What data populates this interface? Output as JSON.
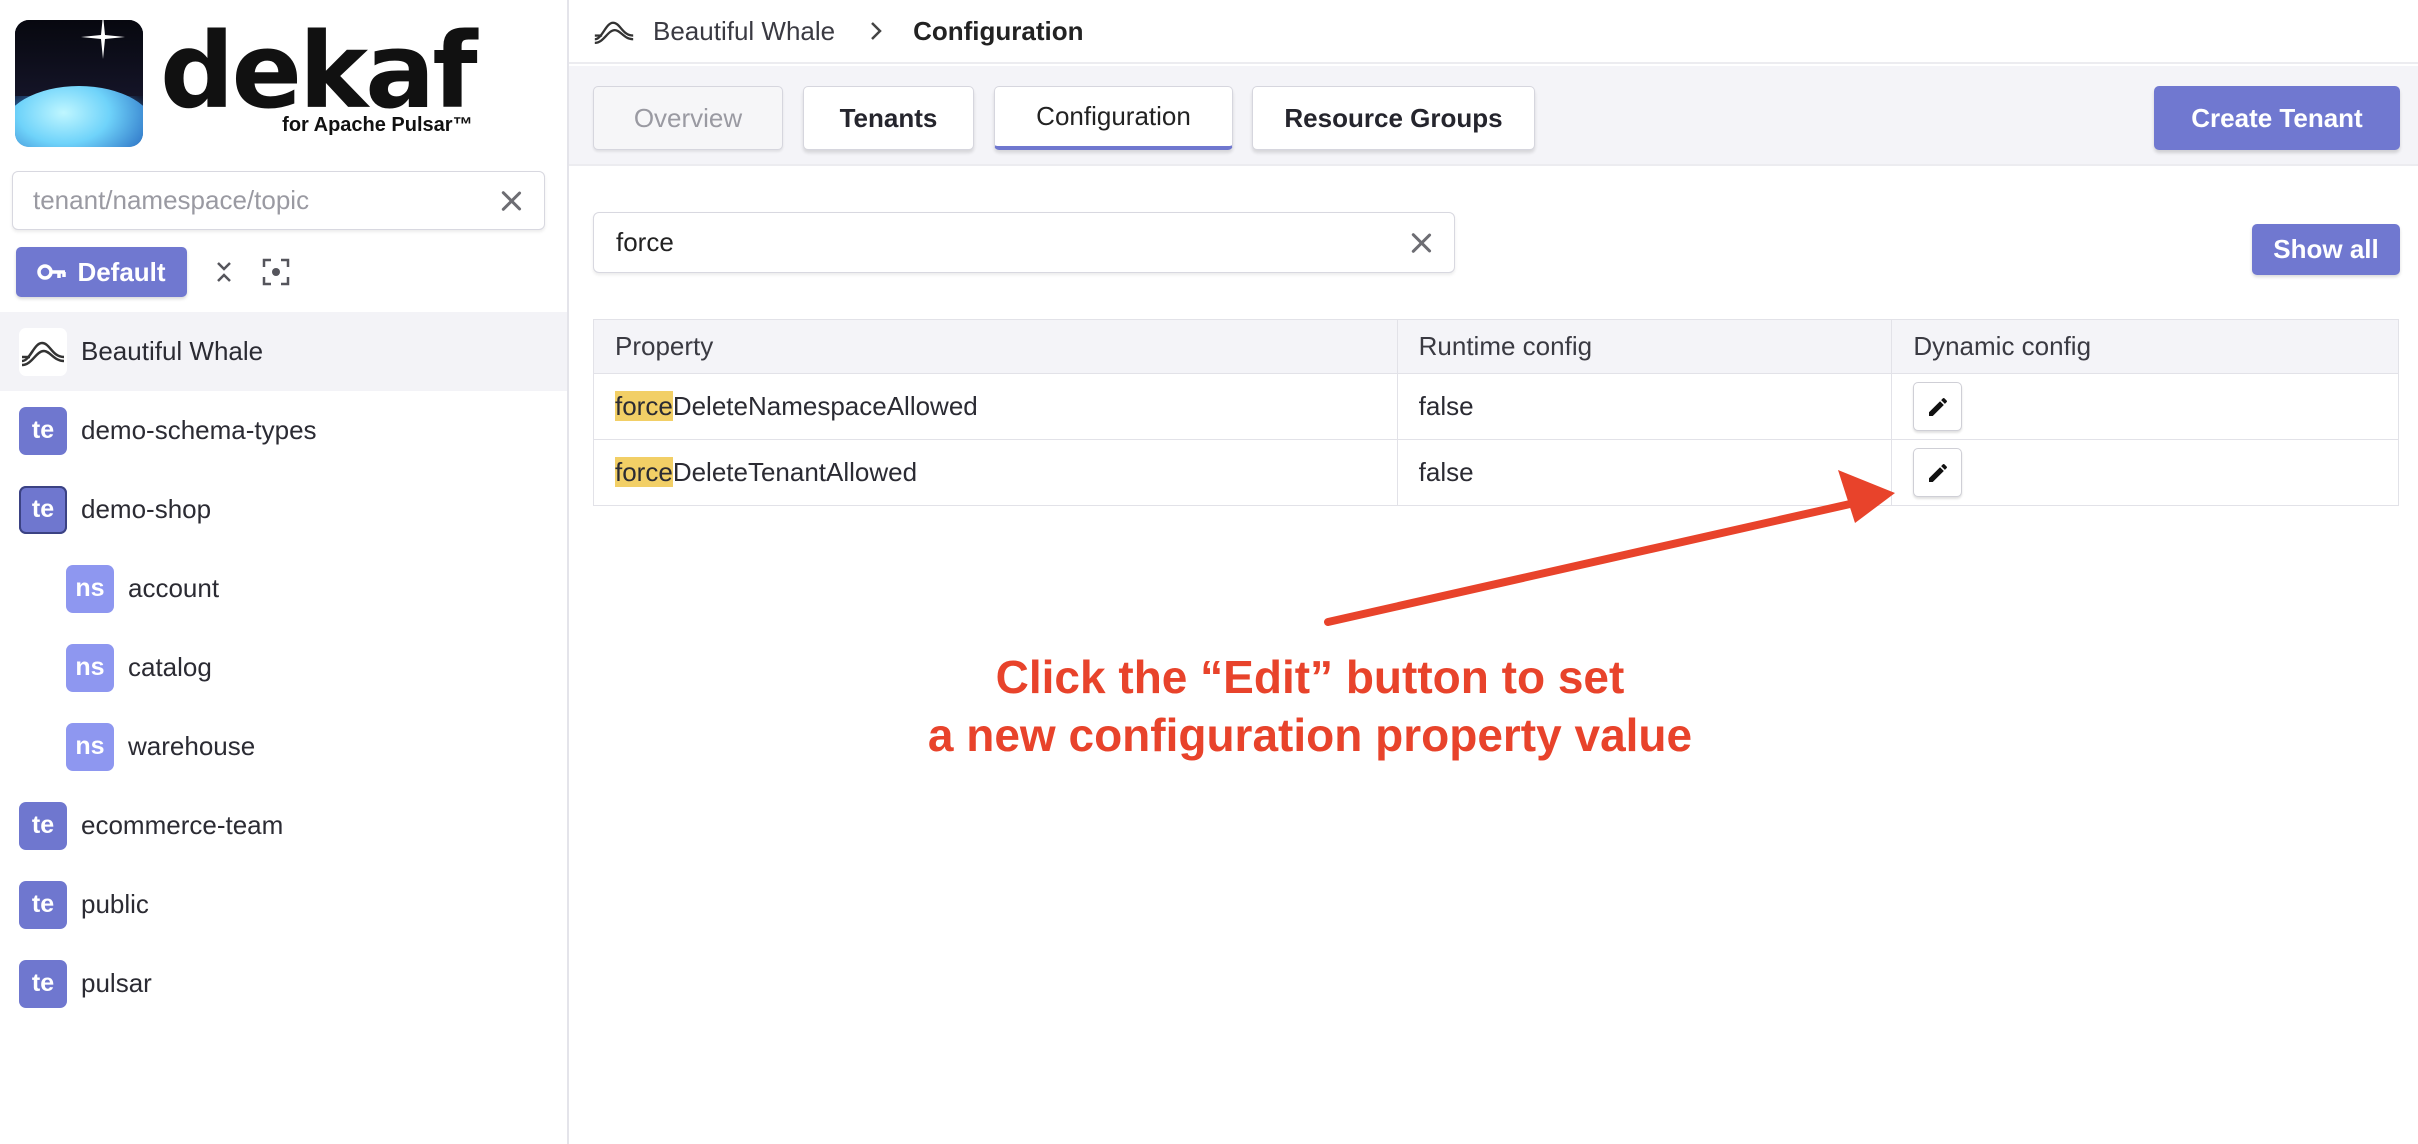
{
  "brand": {
    "name": "dekaf",
    "subtitle": "for Apache Pulsar™"
  },
  "sidebar": {
    "search_placeholder": "tenant/namespace/topic",
    "default_button": "Default",
    "tree": [
      {
        "kind": "cluster",
        "badge": "",
        "label": "Beautiful Whale"
      },
      {
        "kind": "tenant",
        "badge": "te",
        "label": "demo-schema-types"
      },
      {
        "kind": "tenant",
        "badge": "te",
        "label": "demo-shop"
      },
      {
        "kind": "namespace",
        "badge": "ns",
        "label": "account"
      },
      {
        "kind": "namespace",
        "badge": "ns",
        "label": "catalog"
      },
      {
        "kind": "namespace",
        "badge": "ns",
        "label": "warehouse"
      },
      {
        "kind": "tenant",
        "badge": "te",
        "label": "ecommerce-team"
      },
      {
        "kind": "tenant",
        "badge": "te",
        "label": "public"
      },
      {
        "kind": "tenant",
        "badge": "te",
        "label": "pulsar"
      }
    ]
  },
  "breadcrumb": {
    "cluster": "Beautiful Whale",
    "page": "Configuration"
  },
  "tabs": [
    {
      "label": "Overview"
    },
    {
      "label": "Tenants"
    },
    {
      "label": "Configuration"
    },
    {
      "label": "Resource Groups"
    }
  ],
  "create_button": "Create Tenant",
  "filter": {
    "value": "force"
  },
  "show_all_button": "Show all",
  "table": {
    "headers": [
      "Property",
      "Runtime config",
      "Dynamic config"
    ],
    "rows": [
      {
        "match": "force",
        "rest": "DeleteNamespaceAllowed",
        "runtime": "false"
      },
      {
        "match": "force",
        "rest": "DeleteTenantAllowed",
        "runtime": "false"
      }
    ]
  },
  "annotation": {
    "line1": "Click the “Edit” button to set",
    "line2": "a new configuration property value"
  },
  "colors": {
    "accent": "#7078d0",
    "highlight": "#f2cf66",
    "annotation": "#e8432b"
  }
}
